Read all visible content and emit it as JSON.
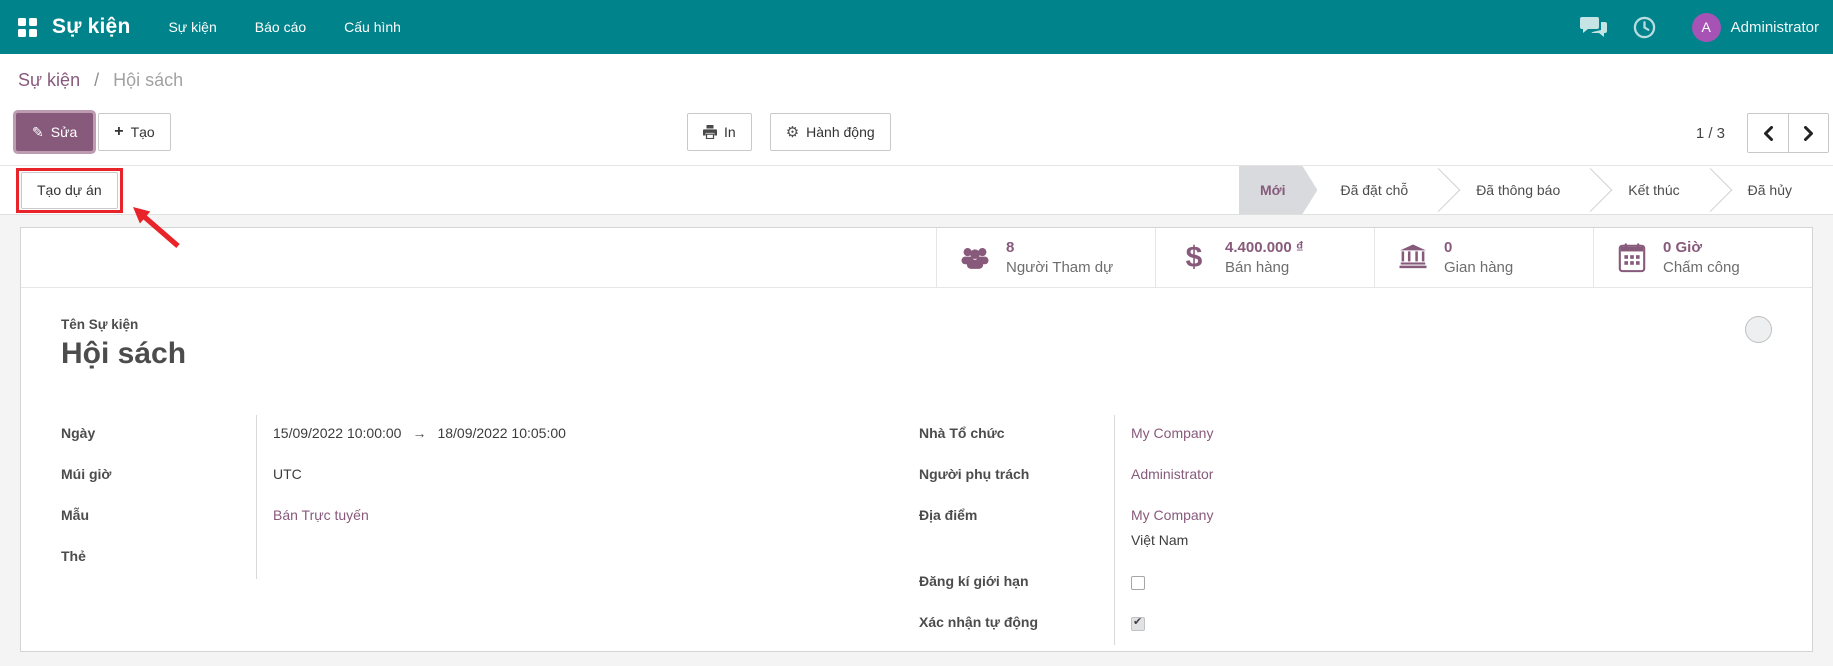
{
  "colors": {
    "topbar": "#00838b",
    "primary": "#875a7b",
    "annotation": "#e8242a",
    "active_stage_bg": "#d8dade"
  },
  "topbar": {
    "brand": "Sự kiện",
    "menus": [
      {
        "label": "Sự kiện"
      },
      {
        "label": "Báo cáo"
      },
      {
        "label": "Cấu hình"
      }
    ],
    "user": {
      "initial": "A",
      "name": "Administrator"
    }
  },
  "breadcrumb": {
    "parent": "Sự kiện",
    "separator": "/",
    "current": "Hội sách"
  },
  "control_panel": {
    "edit_label": "Sửa",
    "edit_icon": "✎",
    "create_label": "Tạo",
    "create_icon": "+",
    "print_label": "In",
    "action_label": "Hành động",
    "action_icon": "⚙",
    "pager": {
      "value": "1 / 3"
    }
  },
  "statusbar": {
    "action_button": "Tạo dự án",
    "stages": [
      {
        "label": "Mới",
        "active": true
      },
      {
        "label": "Đã đặt chỗ",
        "active": false
      },
      {
        "label": "Đã thông báo",
        "active": false
      },
      {
        "label": "Kết thúc",
        "active": false
      },
      {
        "label": "Đã hủy",
        "active": false
      }
    ]
  },
  "stat_buttons": [
    {
      "icon": "users-icon",
      "value": "8",
      "label": "Người Tham dự"
    },
    {
      "icon": "dollar-icon",
      "value": "4.400.000 ₫",
      "label": "Bán hàng",
      "dollar_glyph": "$"
    },
    {
      "icon": "bank-icon",
      "value": "0",
      "label": "Gian hàng"
    },
    {
      "icon": "calendar-icon",
      "value": "0 Giờ",
      "label": "Chấm công"
    }
  ],
  "form": {
    "name_label": "Tên Sự kiện",
    "name_value": "Hội sách",
    "left_fields": [
      {
        "label": "Ngày",
        "date_start": "15/09/2022 10:00:00",
        "arrow": "→",
        "date_end": "18/09/2022 10:05:00"
      },
      {
        "label": "Múi giờ",
        "value": "UTC"
      },
      {
        "label": "Mẫu",
        "value": "Bán Trực tuyến"
      },
      {
        "label": "Thẻ",
        "value": ""
      }
    ],
    "right_fields": [
      {
        "label": "Nhà Tổ chức",
        "value": "My Company"
      },
      {
        "label": "Người phụ trách",
        "value": "Administrator"
      },
      {
        "label": "Địa điểm",
        "value": "My Company",
        "value2": "Việt Nam"
      },
      {
        "label": "Đăng kí giới hạn",
        "checked": false
      },
      {
        "label": "Xác nhận tự động",
        "checked": true,
        "check_glyph": "✔"
      }
    ]
  }
}
